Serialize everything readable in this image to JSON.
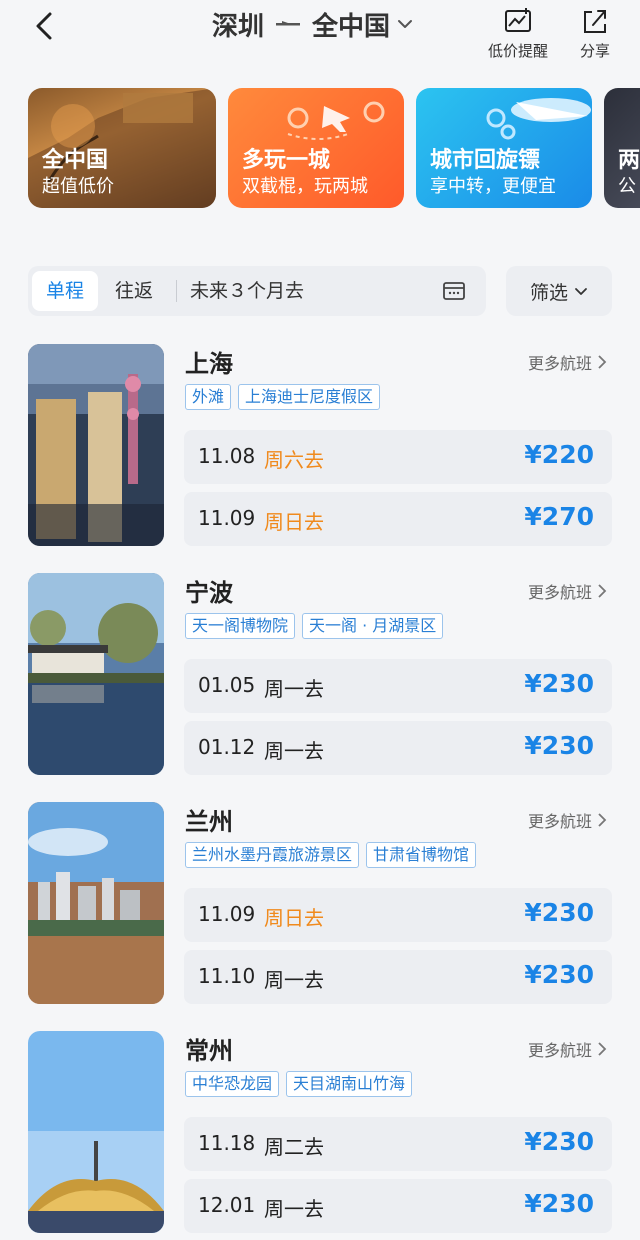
{
  "header": {
    "origin": "深圳",
    "destination": "全中国",
    "price_alert_label": "低价提醒",
    "share_label": "分享",
    "icons": {
      "back": "back-arrow-icon",
      "dropdown": "chevron-down-icon",
      "alert": "chart-alert-icon",
      "share": "share-icon"
    }
  },
  "banners": [
    {
      "title": "全中国",
      "subtitle": "超值低价"
    },
    {
      "title": "多玩一城",
      "subtitle": "双截棍，玩两城"
    },
    {
      "title": "城市回旋镖",
      "subtitle": "享中转，更便宜"
    },
    {
      "title": "两",
      "subtitle": "公"
    }
  ],
  "filters": {
    "tabs": [
      "单程",
      "往返"
    ],
    "active_tab": "单程",
    "when": "未来３个月去",
    "filter_label": "筛选"
  },
  "colors": {
    "accent": "#1a84e6",
    "weekend": "#f08a1d",
    "tag_border": "#9cc4ec"
  },
  "destinations": [
    {
      "city": "上海",
      "more": "更多航班",
      "tags": [
        "外滩",
        "上海迪士尼度假区"
      ],
      "flights": [
        {
          "date": "11.08",
          "day": "周六去",
          "price": "¥220",
          "weekend": true
        },
        {
          "date": "11.09",
          "day": "周日去",
          "price": "¥270",
          "weekend": true
        }
      ]
    },
    {
      "city": "宁波",
      "more": "更多航班",
      "tags": [
        "天一阁博物院",
        "天一阁 · 月湖景区"
      ],
      "flights": [
        {
          "date": "01.05",
          "day": "周一去",
          "price": "¥230",
          "weekend": false
        },
        {
          "date": "01.12",
          "day": "周一去",
          "price": "¥230",
          "weekend": false
        }
      ]
    },
    {
      "city": "兰州",
      "more": "更多航班",
      "tags": [
        "兰州水墨丹霞旅游景区",
        "甘肃省博物馆"
      ],
      "flights": [
        {
          "date": "11.09",
          "day": "周日去",
          "price": "¥230",
          "weekend": true
        },
        {
          "date": "11.10",
          "day": "周一去",
          "price": "¥230",
          "weekend": false
        }
      ]
    },
    {
      "city": "常州",
      "more": "更多航班",
      "tags": [
        "中华恐龙园",
        "天目湖南山竹海"
      ],
      "flights": [
        {
          "date": "11.18",
          "day": "周二去",
          "price": "¥230",
          "weekend": false
        },
        {
          "date": "12.01",
          "day": "周一去",
          "price": "¥230",
          "weekend": false
        }
      ]
    }
  ]
}
